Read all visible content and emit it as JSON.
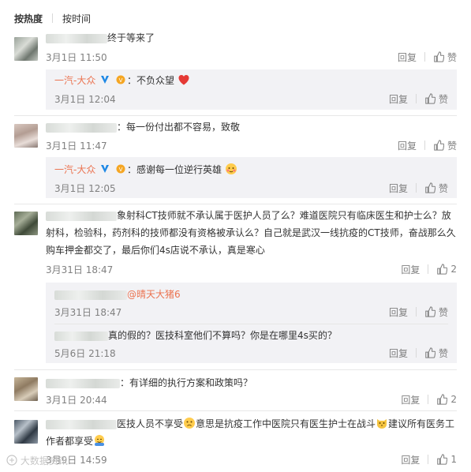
{
  "tabs": {
    "hot": "按热度",
    "time": "按时间"
  },
  "labels": {
    "reply": "回复",
    "like": "赞"
  },
  "comments": [
    {
      "text": "终于等来了",
      "time": "3月1日 11:50",
      "likes": "",
      "reply": {
        "name": "一汽-大众",
        "text": "不负众望",
        "time": "3月1日 12:04",
        "likes": ""
      }
    },
    {
      "text": "：每一份付出都不容易，致敬",
      "time": "3月1日 11:47",
      "likes": "",
      "reply": {
        "name": "一汽-大众",
        "text": "感谢每一位逆行英雄",
        "time": "3月1日 12:05",
        "likes": ""
      }
    },
    {
      "text": "象射科CT技师就不承认属于医护人员了么？难道医院只有临床医生和护士么？放射科，检验科，药剂科的技师都没有资格被承认么？自己就是武汉一线抗疫的CT技师，奋战那么久购车押金都交了，最后你们4s店说不承认，真是寒心",
      "time": "3月31日 18:47",
      "likes": "2",
      "subreplies": [
        {
          "mention": "@晴天大猪6",
          "time": "3月31日 18:47",
          "likes": ""
        },
        {
          "text": "真的假的？医技科室他们不算吗？你是在哪里4s买的？",
          "time": "5月6日 21:18",
          "likes": ""
        }
      ]
    },
    {
      "text": "：有详细的执行方案和政策吗？",
      "time": "3月1日 20:44",
      "likes": "2"
    },
    {
      "text1": "医技人员不享受",
      "text2": "意思是抗疫工作中医院只有医生护士在战斗",
      "text3": "建议所有医务工作者都享受",
      "time": "3月9日 14:59",
      "likes": "1"
    }
  ],
  "watermark": "大数据资讯",
  "colors": {
    "accent": "#eb7350",
    "meta": "#808080",
    "reply_bg": "#f2f2f5"
  }
}
